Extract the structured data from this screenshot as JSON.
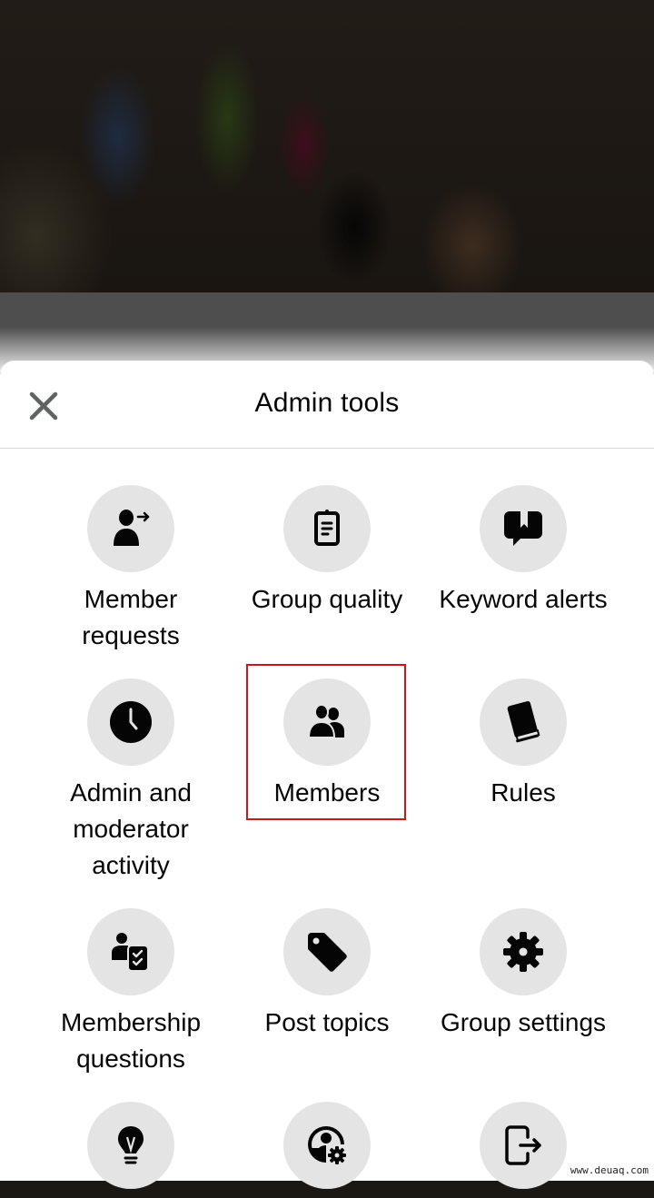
{
  "sheet": {
    "title": "Admin tools",
    "close_icon": "close-icon"
  },
  "tools": [
    {
      "id": "member-requests",
      "label": "Member requests",
      "icon": "person-arrow-icon"
    },
    {
      "id": "group-quality",
      "label": "Group quality",
      "icon": "clipboard-icon"
    },
    {
      "id": "keyword-alerts",
      "label": "Keyword alerts",
      "icon": "speech-bookmark-icon"
    },
    {
      "id": "admin-moderator-activity",
      "label": "Admin and moderator activity",
      "icon": "clock-icon"
    },
    {
      "id": "members",
      "label": "Members",
      "icon": "people-icon",
      "highlighted": true
    },
    {
      "id": "rules",
      "label": "Rules",
      "icon": "book-icon"
    },
    {
      "id": "membership-questions",
      "label": "Membership questions",
      "icon": "person-checklist-icon"
    },
    {
      "id": "post-topics",
      "label": "Post topics",
      "icon": "tag-icon"
    },
    {
      "id": "group-settings",
      "label": "Group settings",
      "icon": "gear-icon"
    },
    {
      "id": "suggestions",
      "label": "",
      "icon": "lightbulb-icon"
    },
    {
      "id": "admin-settings",
      "label": "",
      "icon": "person-gear-icon"
    },
    {
      "id": "leave-group",
      "label": "",
      "icon": "exit-icon"
    }
  ],
  "highlight_color": "#d0121e",
  "watermark": "www.deuaq.com"
}
